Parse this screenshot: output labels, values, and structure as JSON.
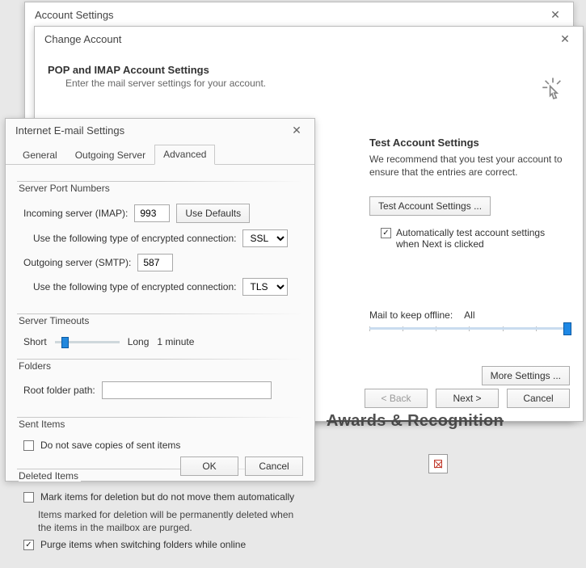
{
  "account_settings": {
    "title": "Account Settings"
  },
  "change_account": {
    "title": "Change Account",
    "heading": "POP and IMAP Account Settings",
    "subtext": "Enter the mail server settings for your account."
  },
  "test": {
    "title": "Test Account Settings",
    "text": "We recommend that you test your account to ensure that the entries are correct.",
    "button": "Test Account Settings ...",
    "auto_checkbox": "Automatically test account settings when Next is clicked"
  },
  "mail_keep": {
    "label": "Mail to keep offline:",
    "value": "All"
  },
  "more_settings": "More Settings ...",
  "nav": {
    "back": "< Back",
    "next": "Next >",
    "cancel": "Cancel"
  },
  "iemail": {
    "title": "Internet E-mail Settings",
    "tabs": {
      "general": "General",
      "outgoing": "Outgoing Server",
      "advanced": "Advanced"
    },
    "server_ports": {
      "legend": "Server Port Numbers",
      "incoming_label": "Incoming server (IMAP):",
      "incoming_value": "993",
      "use_defaults": "Use Defaults",
      "enc_label": "Use the following type of encrypted connection:",
      "incoming_enc": "SSL",
      "outgoing_label": "Outgoing server (SMTP):",
      "outgoing_value": "587",
      "outgoing_enc": "TLS"
    },
    "timeouts": {
      "legend": "Server Timeouts",
      "short": "Short",
      "long": "Long",
      "value": "1 minute"
    },
    "folders": {
      "legend": "Folders",
      "root_label": "Root folder path:",
      "root_value": ""
    },
    "sent": {
      "legend": "Sent Items",
      "nosave": "Do not save copies of sent items"
    },
    "deleted": {
      "legend": "Deleted Items",
      "mark": "Mark items for deletion but do not move them automatically",
      "note": "Items marked for deletion will be permanently deleted when the items in the mailbox are purged.",
      "purge": "Purge items when switching folders while online"
    },
    "buttons": {
      "ok": "OK",
      "cancel": "Cancel"
    }
  },
  "peek": {
    "awards": "Awards & Recognition"
  }
}
